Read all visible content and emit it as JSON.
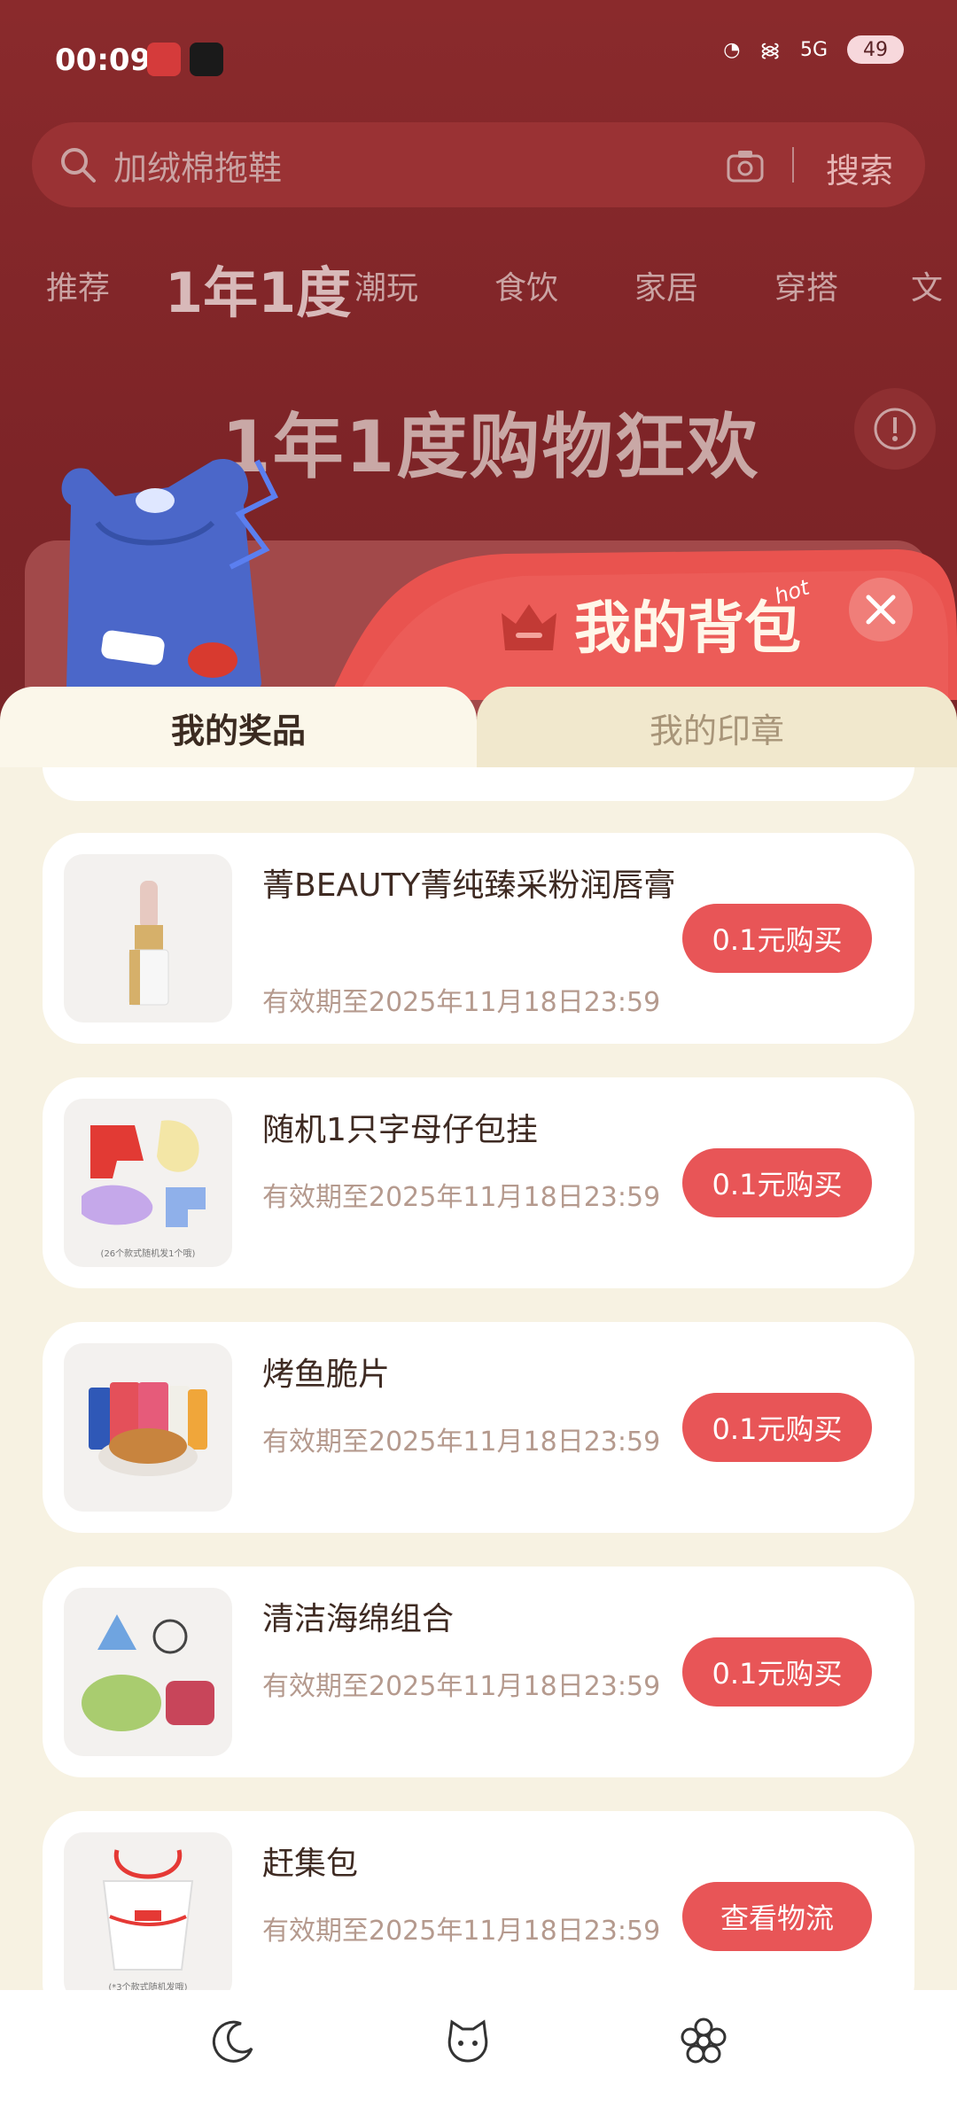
{
  "status_bar": {
    "time": "00:09",
    "network": "5G",
    "battery": "49"
  },
  "search": {
    "placeholder": "加绒棉拖鞋",
    "button_label": "搜索"
  },
  "categories": [
    "推荐",
    "1年1度",
    "潮玩",
    "食饮",
    "家居",
    "穿搭",
    "文"
  ],
  "banner": {
    "title": "1年1度购物狂欢"
  },
  "backpack": {
    "title": "我的背包",
    "hot_badge": "hot"
  },
  "tabs": [
    {
      "label": "我的奖品",
      "active": true
    },
    {
      "label": "我的印章",
      "active": false
    }
  ],
  "prizes": [
    {
      "name": "菁BEAUTY菁纯臻采粉润唇膏",
      "expiry": "有效期至2025年11月18日23:59",
      "action": "0.1元购买",
      "thumb": "lipstick"
    },
    {
      "name": "随机1只字母仔包挂",
      "expiry": "有效期至2025年11月18日23:59",
      "action": "0.1元购买",
      "thumb": "letter-charms",
      "thumb_caption": "(26个款式随机发1个哦)"
    },
    {
      "name": "烤鱼脆片",
      "expiry": "有效期至2025年11月18日23:59",
      "action": "0.1元购买",
      "thumb": "fish-chips"
    },
    {
      "name": "清洁海绵组合",
      "expiry": "有效期至2025年11月18日23:59",
      "action": "0.1元购买",
      "thumb": "sponges"
    },
    {
      "name": "赶集包",
      "expiry": "有效期至2025年11月18日23:59",
      "action": "查看物流",
      "thumb": "tote-bag",
      "thumb_caption": "(*3个款式随机发哦)"
    }
  ],
  "bottom_nav": [
    "moon-icon",
    "cat-face-icon",
    "flower-icon"
  ],
  "colors": {
    "accent_red": "#e85557",
    "sheet_bg": "#f7f2e2",
    "overlay_bg": "#7d2427"
  }
}
